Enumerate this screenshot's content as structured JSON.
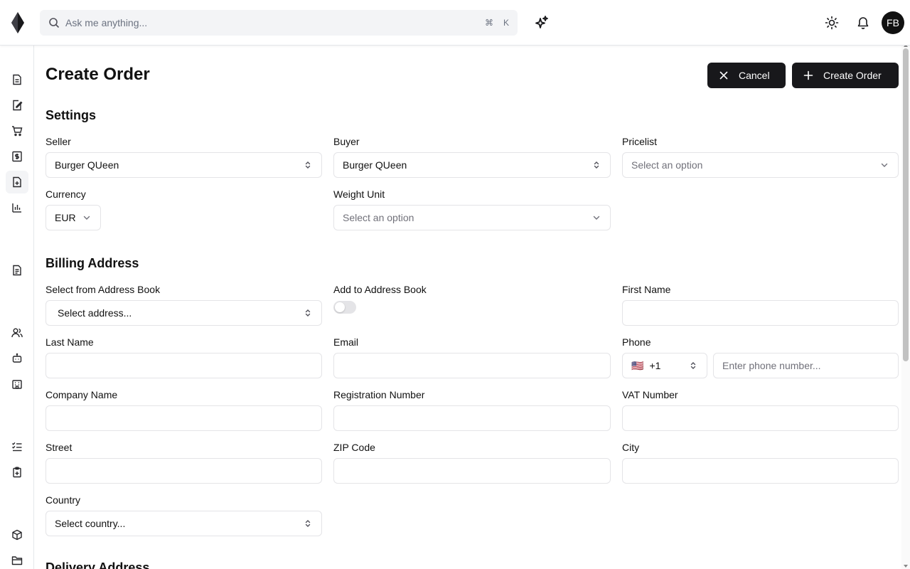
{
  "topbar": {
    "search_placeholder": "Ask me anything...",
    "shortcut_cmd": "⌘",
    "shortcut_key": "K",
    "avatar_initials": "FB"
  },
  "page": {
    "title": "Create Order",
    "cancel_label": "Cancel",
    "create_label": "Create Order"
  },
  "settings": {
    "title": "Settings",
    "seller_label": "Seller",
    "seller_value": "Burger QUeen",
    "buyer_label": "Buyer",
    "buyer_value": "Burger QUeen",
    "pricelist_label": "Pricelist",
    "pricelist_placeholder": "Select an option",
    "currency_label": "Currency",
    "currency_value": "EUR",
    "weight_label": "Weight Unit",
    "weight_placeholder": "Select an option"
  },
  "billing": {
    "title": "Billing Address",
    "address_book_label": "Select from Address Book",
    "address_book_value": "Select address...",
    "add_to_book_label": "Add to Address Book",
    "add_to_book_on": false,
    "first_name_label": "First Name",
    "last_name_label": "Last Name",
    "email_label": "Email",
    "phone_label": "Phone",
    "phone_flag": "🇺🇸",
    "phone_code": "+1",
    "phone_placeholder": "Enter phone number...",
    "company_label": "Company Name",
    "registration_label": "Registration Number",
    "vat_label": "VAT Number",
    "street_label": "Street",
    "zip_label": "ZIP Code",
    "city_label": "City",
    "country_label": "Country",
    "country_value": "Select country..."
  },
  "delivery": {
    "title": "Delivery Address"
  },
  "icons": {
    "color": "#27272a",
    "muted": "#71717a"
  }
}
